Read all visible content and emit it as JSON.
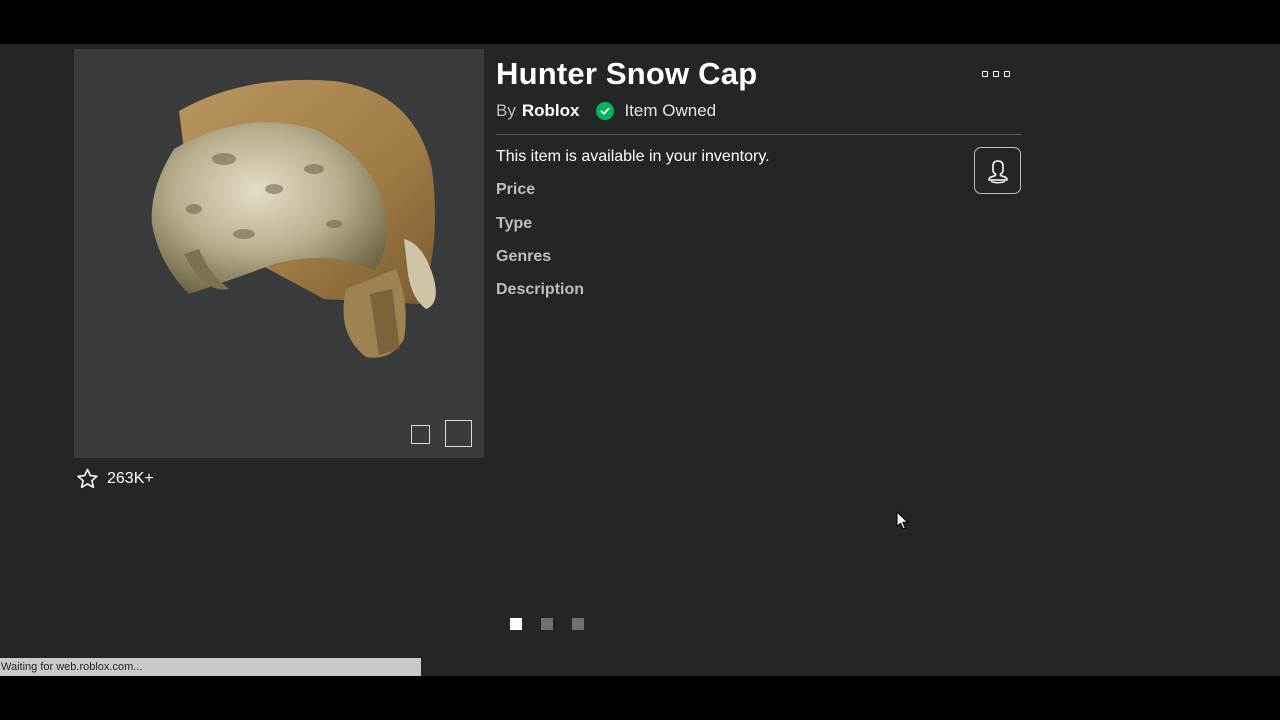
{
  "item": {
    "title": "Hunter Snow Cap",
    "by_label": "By",
    "creator": "Roblox",
    "owned_label": "Item Owned",
    "availability": "This item is available in your inventory.",
    "favorites": "263K+"
  },
  "details": {
    "price_label": "Price",
    "type_label": "Type",
    "genres_label": "Genres",
    "description_label": "Description"
  },
  "icons": {
    "more": "more-options-icon",
    "favorite": "star-outline-icon",
    "owned": "check-circle-icon",
    "try_on": "avatar-try-on-icon"
  },
  "carousel": {
    "count": 3,
    "active_index": 0
  },
  "status_bar": {
    "text": "Waiting for web.roblox.com..."
  },
  "colors": {
    "background": "#232527",
    "thumbnail_bg": "#393b3d",
    "owned_green": "#02b757",
    "text_primary": "#ffffff",
    "text_secondary": "#bdbebe"
  }
}
